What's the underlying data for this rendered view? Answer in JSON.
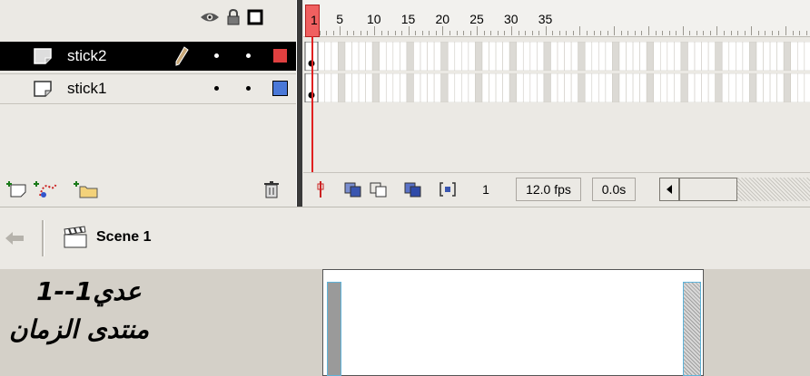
{
  "timeline": {
    "header_icons": [
      "eye-icon",
      "lock-icon",
      "outline-icon"
    ],
    "layers": [
      {
        "name": "stick2",
        "selected": true,
        "editable_icon": "pencil-icon",
        "visible_dot": "•",
        "lock_dot": "•",
        "outline_color": "#e04040"
      },
      {
        "name": "stick1",
        "selected": false,
        "visible_dot": "•",
        "lock_dot": "•",
        "outline_color": "#4a78d8"
      }
    ],
    "footer_icons": [
      "insert-layer-icon",
      "add-motion-guide-icon",
      "insert-layer-folder-icon",
      "delete-layer-icon"
    ],
    "ruler": {
      "current": "1",
      "labels": [
        "5",
        "10",
        "15",
        "20",
        "25",
        "30",
        "35"
      ]
    },
    "status": {
      "current_frame": "1",
      "frame_rate": "12.0 fps",
      "elapsed_time": "0.0s"
    }
  },
  "scene": {
    "label": "Scene 1"
  },
  "stage": {
    "text_line1": "عدي1--1",
    "text_line2": "منتدى الزمان"
  },
  "colors": {
    "selected_row": "#000000",
    "playhead": "#e02020",
    "stick2_outline": "#e04040",
    "stick1_outline": "#4a78d8"
  }
}
